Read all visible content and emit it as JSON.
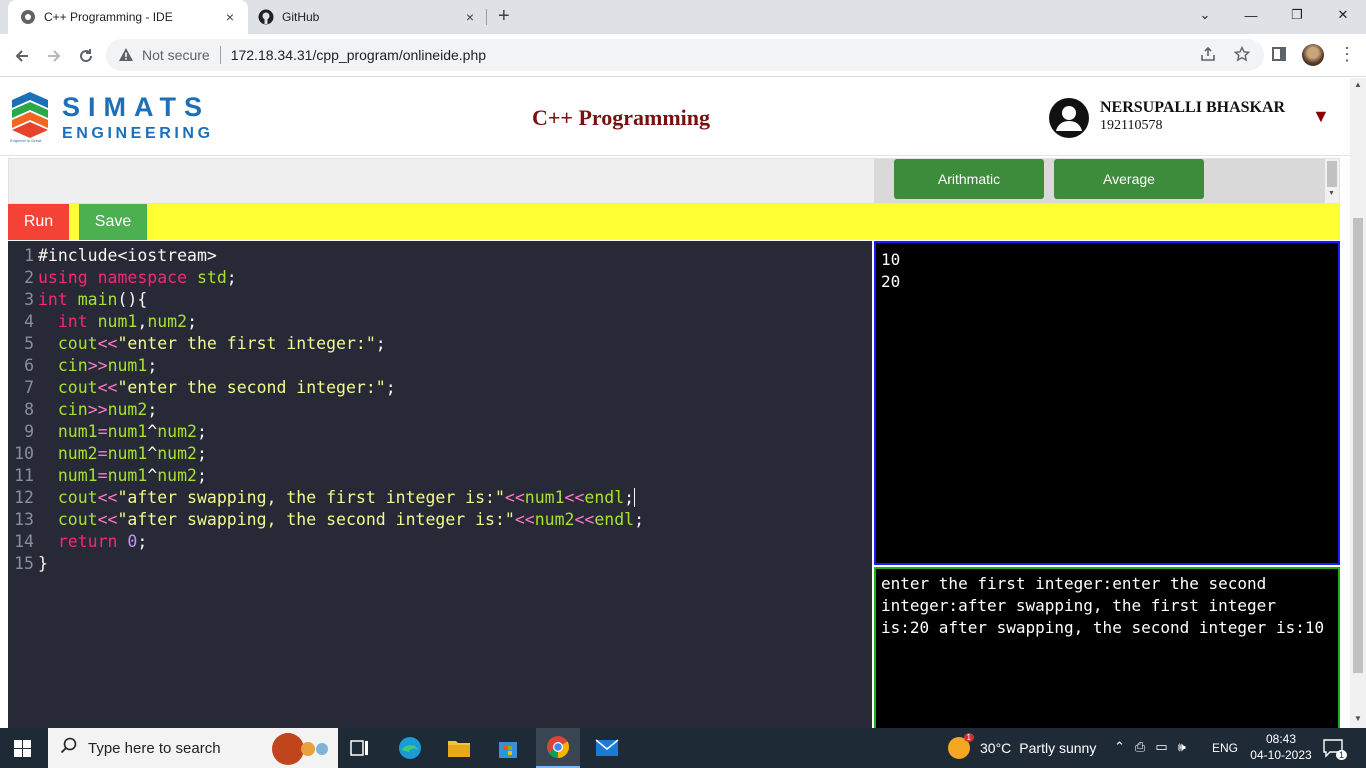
{
  "browser": {
    "tabs": [
      {
        "title": "C++ Programming - IDE",
        "close": "×"
      },
      {
        "title": "GitHub",
        "close": "×"
      }
    ],
    "new_tab": "+",
    "window_controls": {
      "dropdown": "⌄",
      "minimize": "—",
      "restore": "❐",
      "close": "✕"
    },
    "address": {
      "security": "Not secure",
      "url": "172.18.34.31/cpp_program/onlineide.php"
    }
  },
  "header": {
    "logo_line1": "SIMATS",
    "logo_line2": "ENGINEERING",
    "logo_tagline": "Engineer is Great",
    "title": "C++ Programming",
    "user_name": "NERSUPALLI BHASKAR",
    "user_id": "192110578",
    "caret": "▼"
  },
  "programs": [
    "Arithmatic",
    "Average"
  ],
  "actions": {
    "run": "Run",
    "save": "Save"
  },
  "editor": {
    "line_numbers": [
      "1",
      "2",
      "3",
      "4",
      "5",
      "6",
      "7",
      "8",
      "9",
      "10",
      "11",
      "12",
      "13",
      "14",
      "15"
    ]
  },
  "input_pane": "10\n20",
  "output_pane": "enter the first integer:enter the second integer:after swapping, the first integer is:20\nafter swapping, the second integer is:10",
  "taskbar": {
    "search_placeholder": "Type here to search",
    "weather_temp": "30°C",
    "weather_desc": "Partly sunny",
    "language": "ENG",
    "time": "08:43",
    "date": "04-10-2023",
    "notifications": "1",
    "weather_badge": "1"
  },
  "colors": {
    "run": "#f44336",
    "save": "#4caf50",
    "program_button": "#3c8c3c",
    "action_bar": "#ffff33",
    "title": "#7b1010"
  }
}
